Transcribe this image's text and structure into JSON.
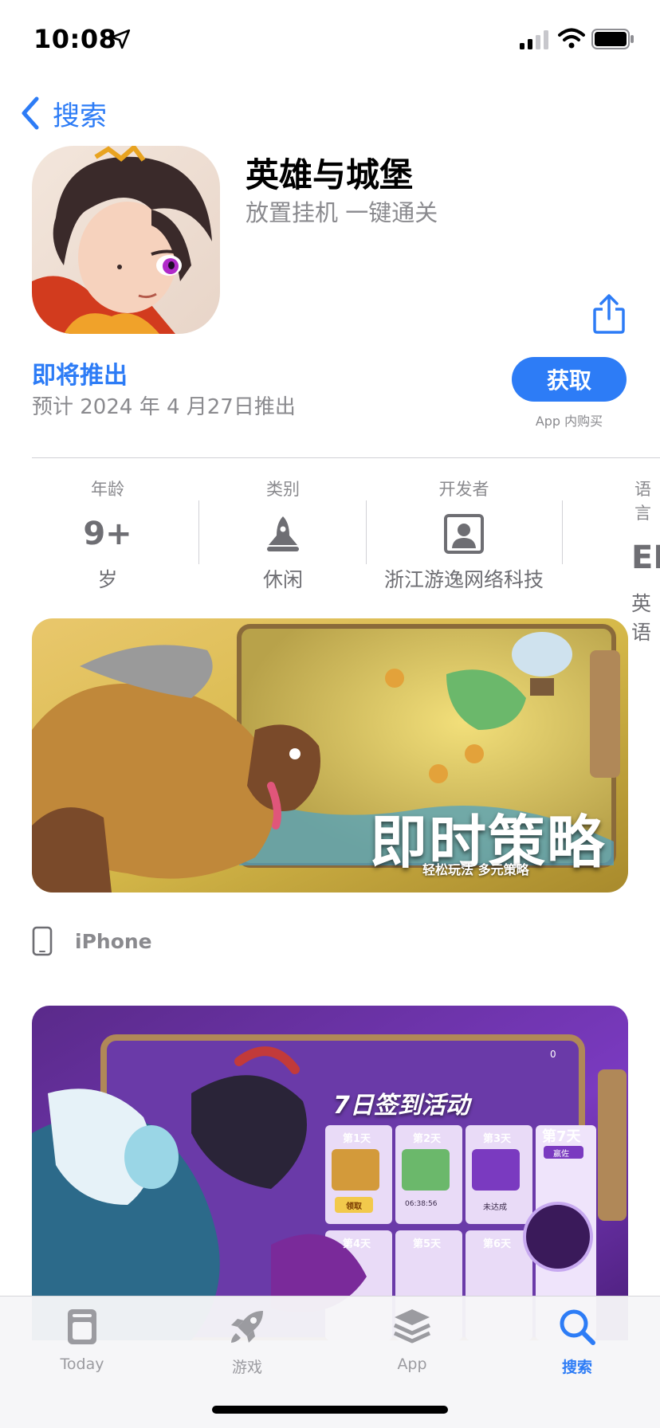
{
  "status_bar": {
    "time": "10:08"
  },
  "nav": {
    "back_label": "搜索"
  },
  "app": {
    "title": "英雄与城堡",
    "subtitle": "放置挂机 一键通关",
    "coming_soon": "即将推出",
    "release_note": "预计 2024 年 4 月27日推出",
    "get_label": "获取",
    "iap_note": "App 内购买"
  },
  "info": {
    "age": {
      "label": "年龄",
      "value": "9+",
      "sub": "岁"
    },
    "category": {
      "label": "类别",
      "sub": "休闲"
    },
    "developer": {
      "label": "开发者",
      "sub": "浙江游逸网络科技"
    },
    "language": {
      "label": "语言",
      "value": "EN",
      "sub": "英语"
    }
  },
  "screenshot1": {
    "headline": "即时策略",
    "tagline": "轻松玩法 多元策略"
  },
  "device": {
    "label": "iPhone"
  },
  "screenshot2": {
    "headline": "7日签到活动",
    "days": [
      "第1天",
      "第2天",
      "第3天",
      "第4天",
      "第5天",
      "第6天"
    ],
    "day7": "第7天",
    "day7_badge": "赢佐",
    "day1_button": "领取",
    "day2_timer": "06:38:56",
    "day3_status": "未达成",
    "gem_count": "0"
  },
  "tabs": [
    {
      "label": "Today",
      "icon": "today-icon"
    },
    {
      "label": "游戏",
      "icon": "rocket-icon"
    },
    {
      "label": "App",
      "icon": "layers-icon"
    },
    {
      "label": "搜索",
      "icon": "search-icon"
    }
  ],
  "colors": {
    "accent": "#2d7cf6",
    "secondary_text": "#8a8a8e"
  }
}
